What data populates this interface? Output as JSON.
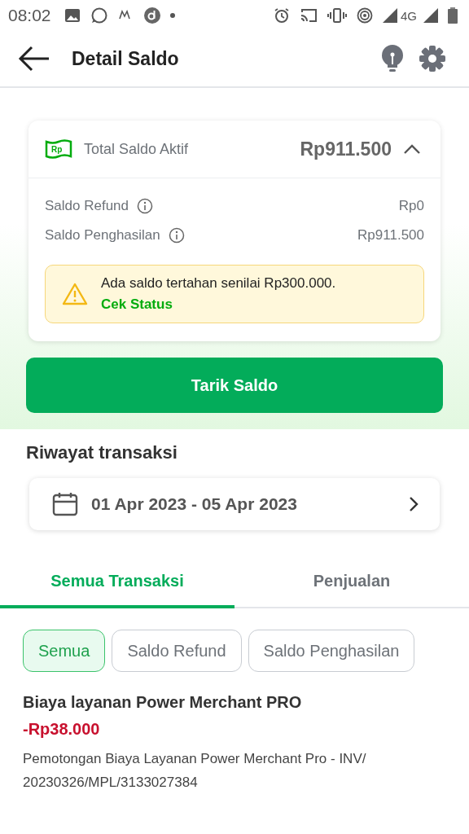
{
  "status_bar": {
    "time": "08:02",
    "network": "4G"
  },
  "app_bar": {
    "title": "Detail Saldo"
  },
  "balance_card": {
    "label": "Total Saldo Aktif",
    "logo": "Rp",
    "amount": "Rp911.500",
    "expanded": true,
    "rows": [
      {
        "label": "Saldo Refund",
        "value": "Rp0"
      },
      {
        "label": "Saldo Penghasilan",
        "value": "Rp911.500"
      }
    ],
    "notice": {
      "text": "Ada saldo tertahan senilai Rp300.000.",
      "link": "Cek Status"
    }
  },
  "withdraw_button": "Tarik Saldo",
  "history": {
    "title": "Riwayat transaksi",
    "date_range": "01 Apr 2023 - 05 Apr 2023",
    "tabs": [
      {
        "label": "Semua Transaksi",
        "selected": true
      },
      {
        "label": "Penjualan",
        "selected": false
      }
    ],
    "filters": [
      {
        "label": "Semua",
        "selected": true
      },
      {
        "label": "Saldo Refund",
        "selected": false
      },
      {
        "label": "Saldo Penghasilan",
        "selected": false
      }
    ],
    "transactions": [
      {
        "title": "Biaya layanan Power Merchant PRO",
        "amount": "-Rp38.000",
        "kind": "debit",
        "description": "Pemotongan Biaya Layanan Power Merchant Pro - INV/ 20230326/MPL/3133027384"
      }
    ]
  }
}
